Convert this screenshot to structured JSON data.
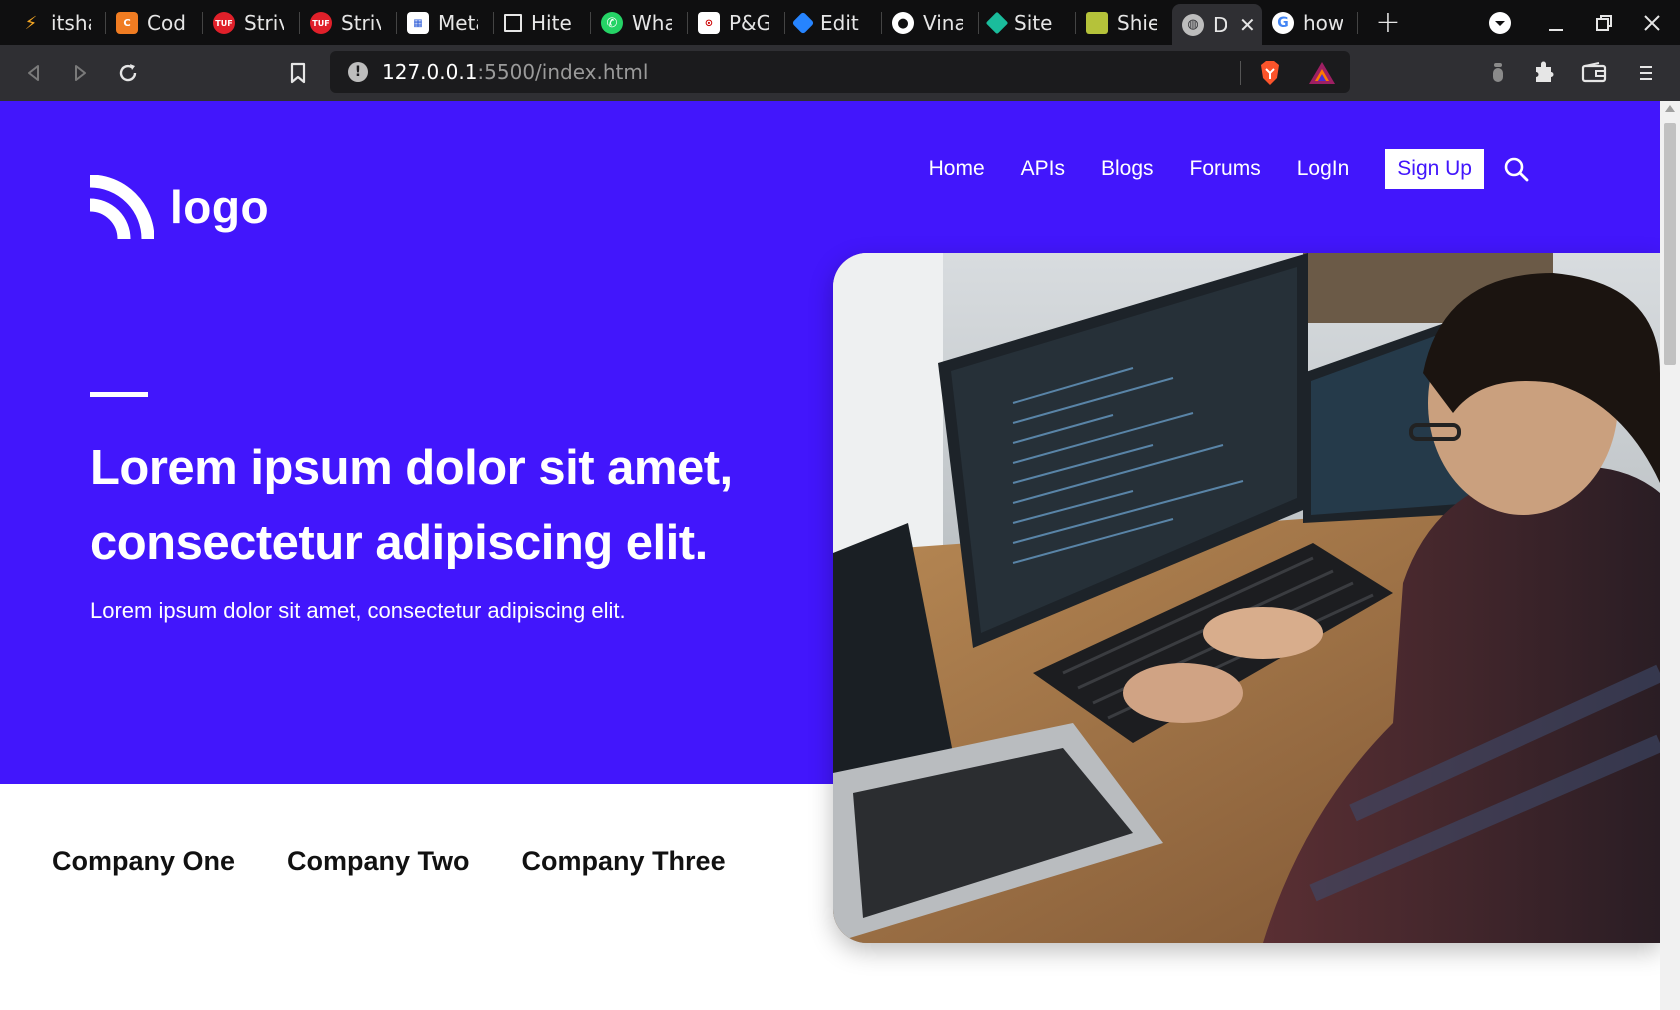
{
  "browser": {
    "tabs": [
      {
        "title": "itsha",
        "icon": "lightning-icon",
        "color": "#f5a623"
      },
      {
        "title": "Code",
        "icon": "codechef-icon",
        "color": "#f07c22"
      },
      {
        "title": "Striv",
        "icon": "tuf-icon",
        "color": "#e0202a"
      },
      {
        "title": "Striv",
        "icon": "tuf-icon",
        "color": "#e0202a"
      },
      {
        "title": "Meta",
        "icon": "meta-icon",
        "color": "#ffffff"
      },
      {
        "title": "Hites",
        "icon": "square-icon",
        "color": "#ffffff"
      },
      {
        "title": "What",
        "icon": "whatsapp-icon",
        "color": "#25d366"
      },
      {
        "title": "P&G",
        "icon": "pg-icon",
        "color": "#ffffff"
      },
      {
        "title": "Editi",
        "icon": "jira-icon",
        "color": "#2684ff"
      },
      {
        "title": "Vinay",
        "icon": "github-icon",
        "color": "#ffffff"
      },
      {
        "title": "Site",
        "icon": "diamond-icon",
        "color": "#1abc9c"
      },
      {
        "title": "Shiel",
        "icon": "shield-icon",
        "color": "#b5c23a"
      },
      {
        "title": "D",
        "icon": "globe-icon",
        "color": "#bdbdbd",
        "active": true
      },
      {
        "title": "how",
        "icon": "google-icon",
        "color": "#ffffff"
      }
    ],
    "url_host": "127.0.0.1",
    "url_rest": ":5500/index.html"
  },
  "page": {
    "logo_text": "logo",
    "nav": {
      "items": [
        "Home",
        "APIs",
        "Blogs",
        "Forums",
        "LogIn"
      ],
      "signup": "Sign Up"
    },
    "hero": {
      "title": "Lorem ipsum dolor sit amet, consectetur adipiscing elit.",
      "subtitle": "Lorem ipsum dolor sit amet, consectetur adipiscing elit."
    },
    "companies": [
      "Company One",
      "Company Two",
      "Company Three"
    ],
    "colors": {
      "brand": "#4216fc",
      "white": "#ffffff"
    }
  }
}
